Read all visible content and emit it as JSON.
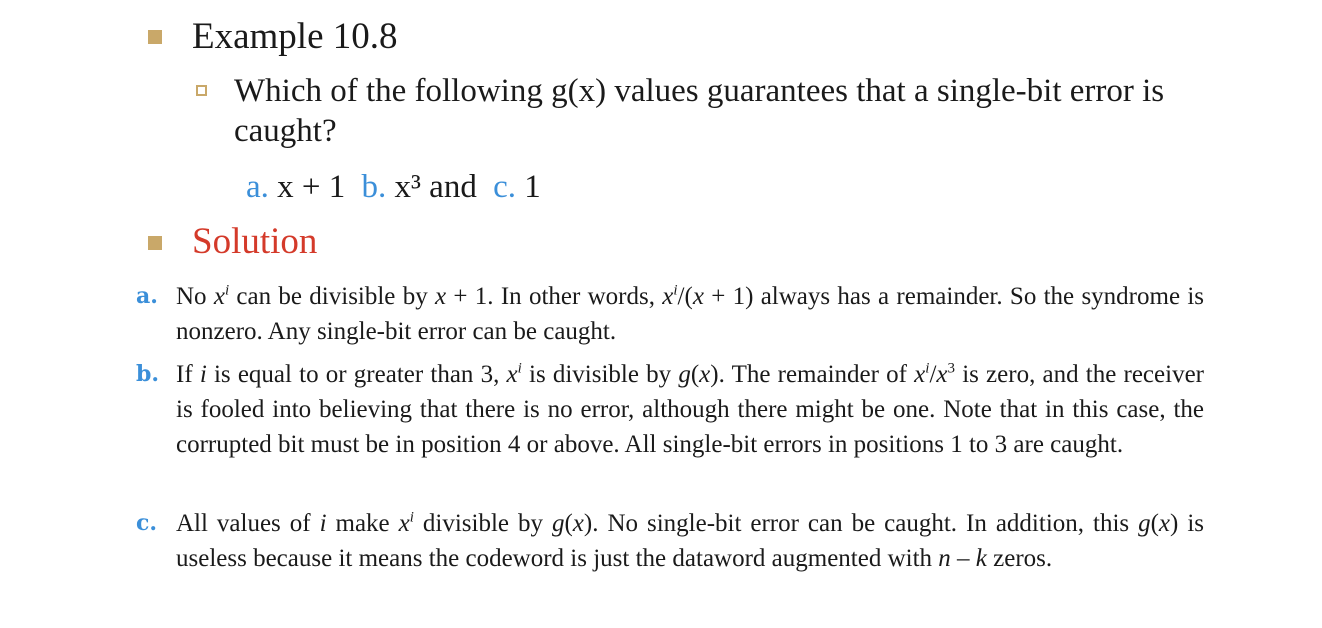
{
  "example": {
    "title": "Example 10.8",
    "question": "Which of the following g(x) values guarantees that a single-bit error is caught?",
    "options": [
      {
        "letter": "a.",
        "expr": "x + 1"
      },
      {
        "letter": "b.",
        "expr": "x³ and"
      },
      {
        "letter": "c.",
        "expr": "1"
      }
    ]
  },
  "solution": {
    "title": "Solution",
    "items": [
      {
        "letter": "a.",
        "parts": [
          "No ",
          "x",
          "i",
          " can be divisible by ",
          "x",
          " + 1. In other words, ",
          "x",
          "i",
          "/(",
          "x",
          " + 1) always has a remainder. So the syndrome is nonzero. Any single-bit error can be caught."
        ]
      },
      {
        "letter": "b.",
        "parts": [
          "If ",
          "i",
          " is equal to or greater than 3, ",
          "x",
          "i",
          " is divisible by ",
          "g",
          "(",
          "x",
          "). The remainder of ",
          "x",
          "i",
          "/",
          "x",
          "3",
          " is zero, and the receiver is fooled into believing that there is no error, although there might be one. Note that in this case, the corrupted bit must be in position 4 or above. All single-bit errors in positions 1 to 3 are caught."
        ]
      },
      {
        "letter": "c.",
        "parts": [
          "All values of ",
          "i",
          " make ",
          "x",
          "i",
          " divisible by ",
          "g",
          "(",
          "x",
          "). No single-bit error can be caught. In addition, this ",
          "g",
          "(",
          "x",
          ") is useless because it means the codeword is just the dataword augmented with ",
          "n",
          " – ",
          "k",
          " zeros."
        ]
      }
    ]
  }
}
